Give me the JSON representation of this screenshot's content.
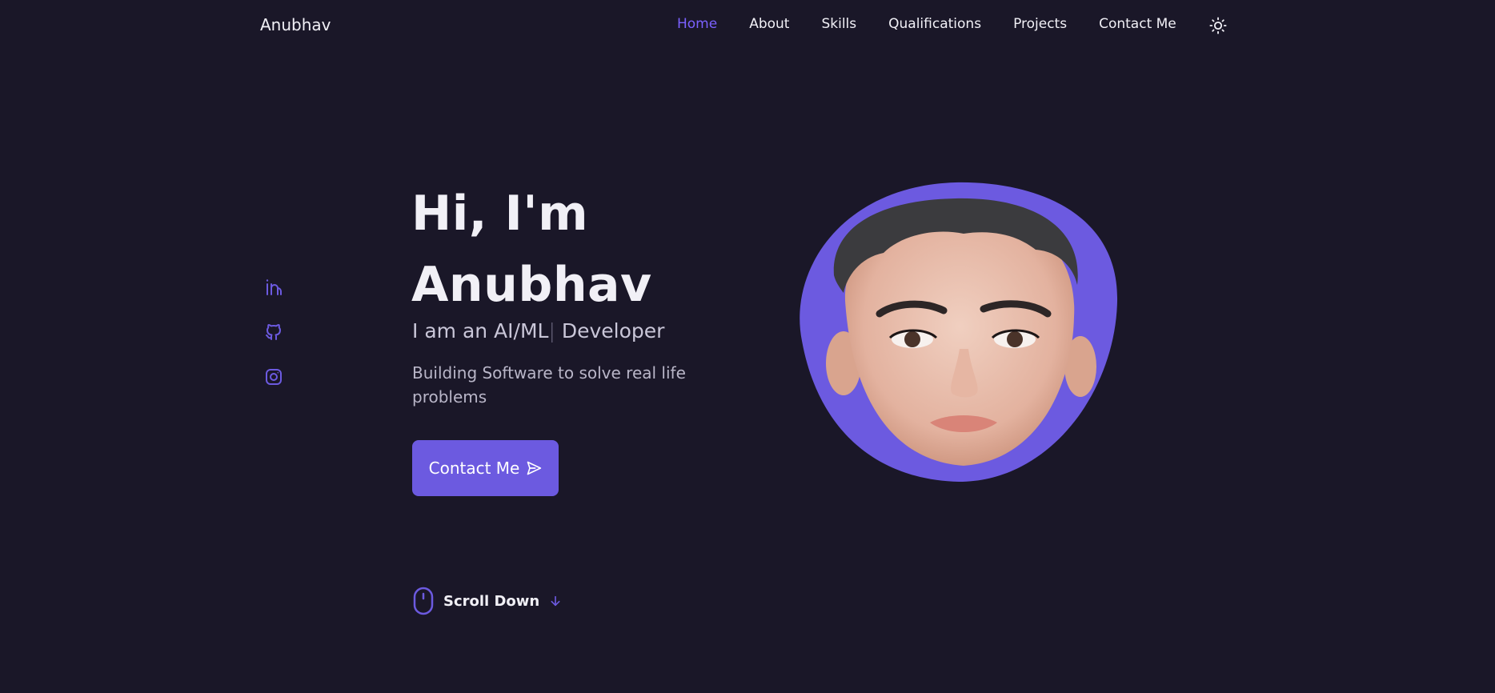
{
  "header": {
    "logo": "Anubhav",
    "nav": [
      {
        "label": "Home",
        "active": true
      },
      {
        "label": "About",
        "active": false
      },
      {
        "label": "Skills",
        "active": false
      },
      {
        "label": "Qualifications",
        "active": false
      },
      {
        "label": "Projects",
        "active": false
      },
      {
        "label": "Contact Me",
        "active": false
      }
    ],
    "theme_toggle_icon": "sun-icon"
  },
  "social": [
    {
      "icon": "linkedin-icon"
    },
    {
      "icon": "github-icon"
    },
    {
      "icon": "instagram-icon"
    }
  ],
  "hero": {
    "title_line1": "Hi, I'm",
    "title_line2": "Anubhav",
    "subtitle_prefix": "I am an AI/ML",
    "subtitle_cursor": "|",
    "subtitle_suffix": " Developer",
    "description": "Building Software to solve real life problems",
    "cta_label": "Contact Me",
    "cta_icon": "send-icon"
  },
  "scroll": {
    "label": "Scroll Down",
    "mouse_icon": "mouse-icon",
    "arrow_icon": "arrow-down-icon"
  },
  "colors": {
    "background": "#1a1728",
    "accent": "#6c5ae0",
    "nav_active": "#7b61ff",
    "text": "#f1f0f6"
  }
}
